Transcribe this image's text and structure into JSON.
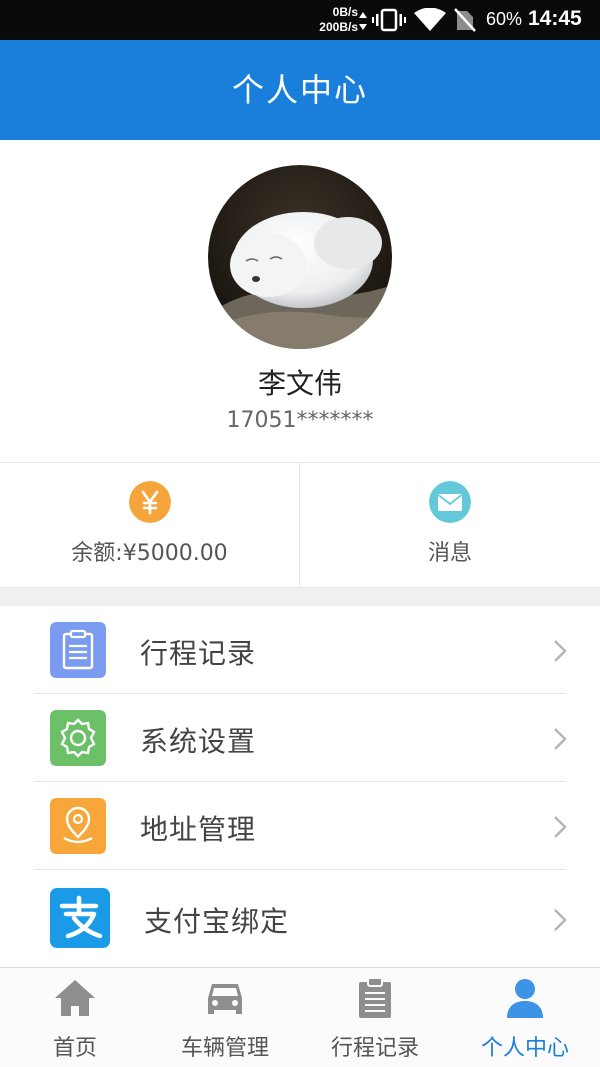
{
  "status_bar": {
    "net_down": "0B/s",
    "net_up": "200B/s",
    "battery": "60%",
    "time": "14:45"
  },
  "header": {
    "title": "个人中心"
  },
  "profile": {
    "name": "李文伟",
    "phone": "17051*******"
  },
  "quick_actions": {
    "balance_label": "余额:¥5000.00",
    "balance_icon": "yen-icon",
    "message_label": "消息",
    "message_icon": "envelope-icon"
  },
  "menu": {
    "items": [
      {
        "label": "行程记录",
        "icon": "clipboard-icon",
        "color": "#7b9bf0"
      },
      {
        "label": "系统设置",
        "icon": "gear-icon",
        "color": "#6cc068"
      },
      {
        "label": "地址管理",
        "icon": "location-pin-icon",
        "color": "#f7a63a"
      },
      {
        "label": "支付宝绑定",
        "icon": "alipay-icon",
        "color": "#1a9be8"
      }
    ]
  },
  "bottom_nav": {
    "items": [
      {
        "label": "首页",
        "icon": "home-icon"
      },
      {
        "label": "车辆管理",
        "icon": "car-icon"
      },
      {
        "label": "行程记录",
        "icon": "clipboard-icon"
      },
      {
        "label": "个人中心",
        "icon": "person-icon",
        "active": true
      }
    ]
  },
  "colors": {
    "primary": "#1a7fdb",
    "yen_badge": "#f6a43c",
    "mail_badge": "#63c9d8"
  }
}
